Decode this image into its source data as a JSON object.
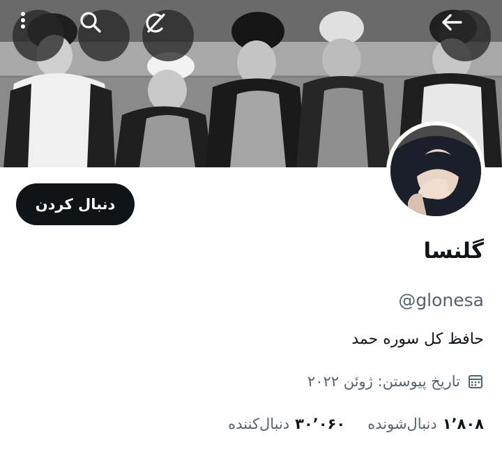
{
  "header": {
    "back_icon": "arrow-left-icon",
    "grok_icon": "slash-circle-icon",
    "search_icon": "search-icon",
    "more_icon": "more-vertical-icon"
  },
  "profile": {
    "name": "گلنسا",
    "handle": "@glonesa",
    "bio": "حافظ کل سوره حمد",
    "joined": "تاریخ پیوستن: ژوئن ۲۰۲۲",
    "follow_label": "دنبال کردن",
    "following_count": "۱٬۸۰۸",
    "following_label": "دنبال‌شونده",
    "followers_count": "۳۰٬۰۶۰",
    "followers_label": "دنبال‌کننده"
  },
  "colors": {
    "primary_text": "#0f1419",
    "secondary_text": "#536471",
    "button_bg": "#0f1419",
    "button_text": "#ffffff"
  }
}
